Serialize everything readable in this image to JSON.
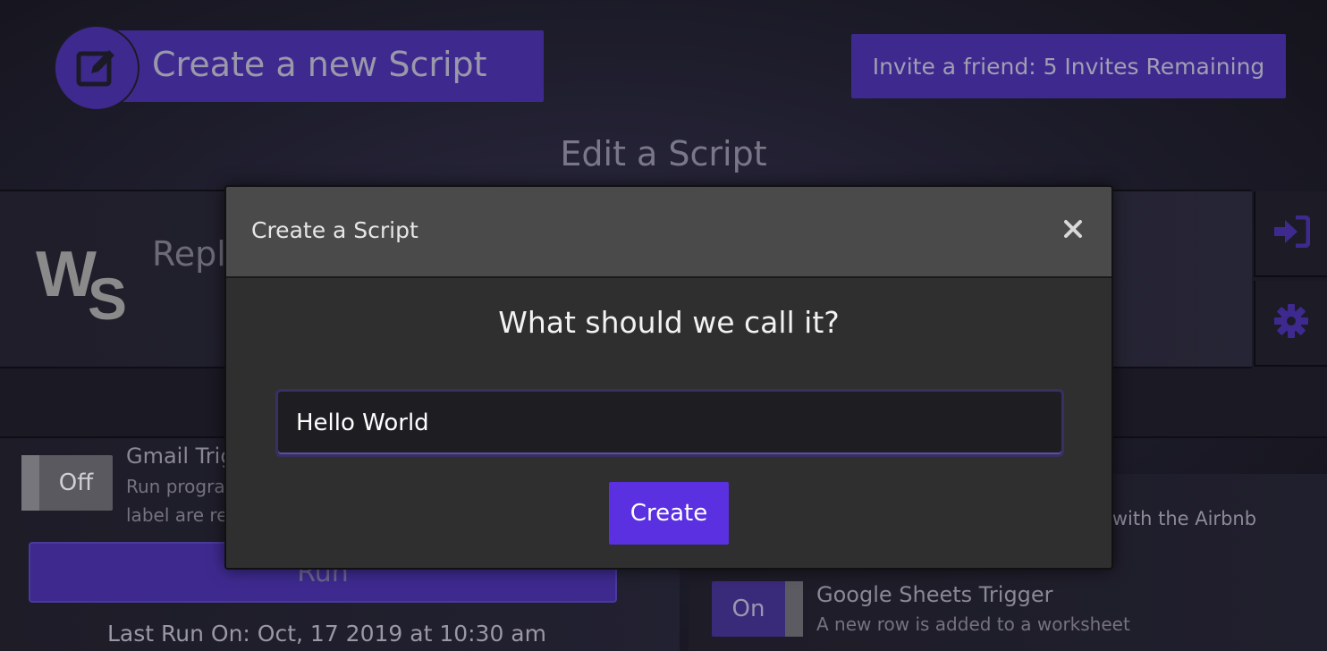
{
  "header": {
    "new_script_label": "Create a new Script",
    "invite_label": "Invite a friend: 5 Invites Remaining",
    "edit_title": "Edit a Script"
  },
  "script_card": {
    "logo_w": "W",
    "logo_s": "S",
    "title": "Repl"
  },
  "gmail_trigger": {
    "toggle_label": "Off",
    "title": "Gmail Trig",
    "desc_line1": "Run progra",
    "desc_line2": "label are re"
  },
  "run_button_label": "Run",
  "last_run": "Last Run On: Oct, 17 2019 at 10:30 am",
  "airbnb_desc": "ges with the Airbnb",
  "sheets_trigger": {
    "toggle_label": "On",
    "title": "Google Sheets Trigger",
    "desc": "A new row is added to a worksheet"
  },
  "modal": {
    "title": "Create a Script",
    "question": "What should we call it?",
    "input_value": "Hello World",
    "create_label": "Create"
  },
  "icons": {
    "edit": "edit-icon",
    "close": "close-icon",
    "sign_in": "sign-in-icon",
    "gear": "gear-icon"
  },
  "colors": {
    "accent": "#5a30e0",
    "accent_dim": "#3e2a8f"
  }
}
